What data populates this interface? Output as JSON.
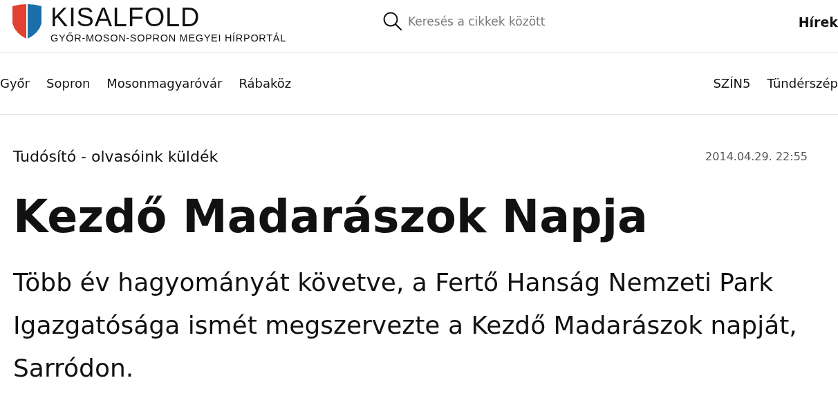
{
  "header": {
    "logo": {
      "title": "KISALFOLD",
      "subtitle": "GYŐR-MOSON-SOPRON MEGYEI HÍRPORTÁL"
    },
    "search": {
      "placeholder": "Keresés a cikkek között"
    },
    "menu_link": "Hírek"
  },
  "nav": {
    "left": [
      "Győr",
      "Sopron",
      "Mosonmagyaróvár",
      "Rábaköz"
    ],
    "right": [
      "SZÍN5",
      "Tündérszép"
    ]
  },
  "article": {
    "category": "Tudósító - olvasóink küldék",
    "date": "2014.04.29. 22:55",
    "title": "Kezdő Madarászok Napja",
    "lead": "Több év hagyományát követve, a Fertő Hanság Nemzeti Park Igazgatósága ismét megszervezte a Kezdő Madarászok napját, Sarródon."
  }
}
